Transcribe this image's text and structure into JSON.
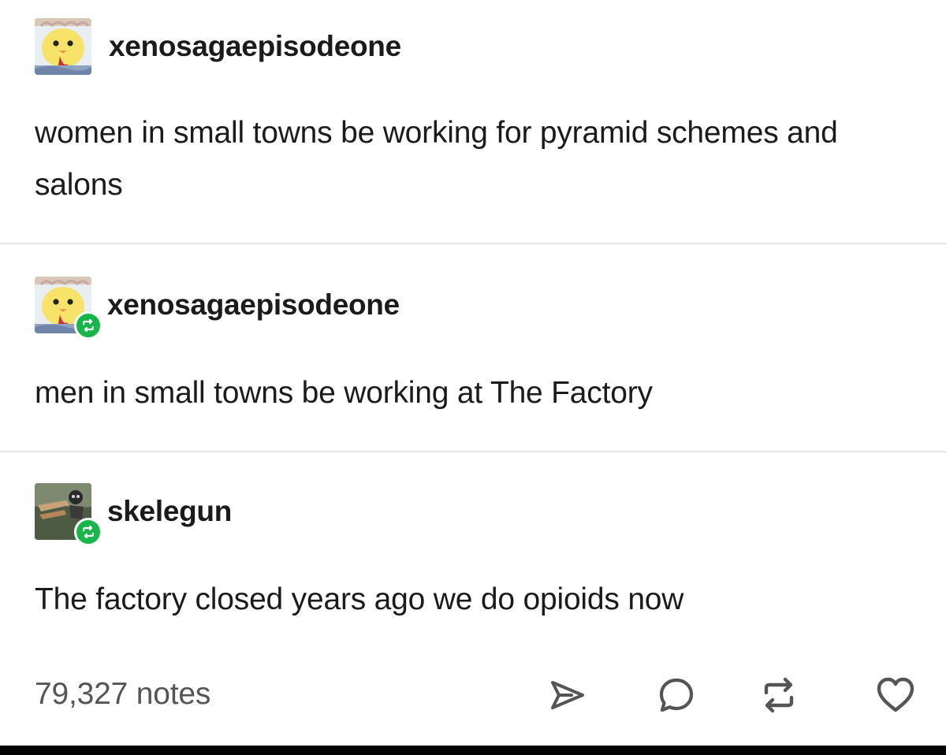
{
  "posts": [
    {
      "username": "xenosagaepisodeone",
      "avatar_icon": "chick-avatar-icon",
      "reblogged": false,
      "body": "women in small towns be working for pyramid schemes and salons"
    },
    {
      "username": "xenosagaepisodeone",
      "avatar_icon": "chick-avatar-icon",
      "reblogged": true,
      "body": "men in small towns be working at The Factory"
    },
    {
      "username": "skelegun",
      "avatar_icon": "skeleton-avatar-icon",
      "reblogged": true,
      "body": "The factory closed years ago we do opioids now"
    }
  ],
  "footer": {
    "notes": "79,327 notes",
    "actions": [
      "share-icon",
      "reply-icon",
      "reblog-icon",
      "heart-icon"
    ]
  },
  "colors": {
    "text": "#1b1b1b",
    "muted_text": "#555555",
    "reblog_badge": "#17b64a",
    "divider": "#e3e3e3"
  }
}
